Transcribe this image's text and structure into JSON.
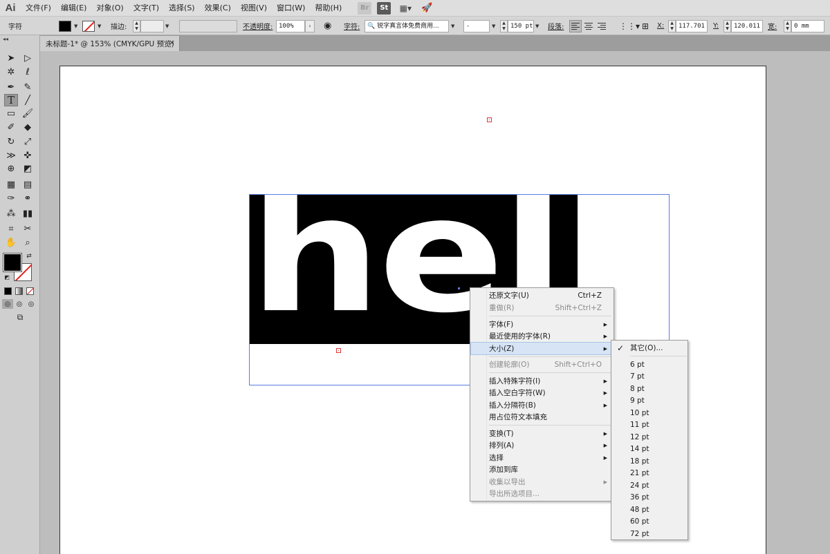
{
  "app": {
    "logo": "Ai"
  },
  "menubar": {
    "items": [
      "文件(F)",
      "编辑(E)",
      "对象(O)",
      "文字(T)",
      "选择(S)",
      "效果(C)",
      "视图(V)",
      "窗口(W)",
      "帮助(H)"
    ],
    "bridge_label": "Br",
    "stock_label": "St"
  },
  "controlbar": {
    "panel_label": "字符",
    "stroke_label": "描边:",
    "opacity_label": "不透明度:",
    "opacity_value": "100%",
    "character_label": "字符:",
    "font_name": "锐字真言体免费商用...",
    "font_style": "-",
    "font_size": "150 pt",
    "paragraph_label": "段落:",
    "x_label": "X:",
    "x_value": "117.701 m",
    "y_label": "Y:",
    "y_value": "120.011 m",
    "w_label": "宽:",
    "w_value": "0 mm"
  },
  "tab": {
    "title": "未标题-1* @ 153% (CMYK/GPU 预览)",
    "close": "×"
  },
  "artboard": {
    "text": "hello"
  },
  "context_menu": {
    "items": [
      {
        "label": "还原文字(U)",
        "shortcut": "Ctrl+Z",
        "enabled": true
      },
      {
        "label": "重做(R)",
        "shortcut": "Shift+Ctrl+Z",
        "enabled": false
      },
      {
        "label": "字体(F)",
        "enabled": true,
        "submenu": true
      },
      {
        "label": "最近使用的字体(R)",
        "enabled": true,
        "submenu": true
      },
      {
        "label": "大小(Z)",
        "enabled": true,
        "submenu": true,
        "highlighted": true
      },
      {
        "label": "创建轮廓(O)",
        "shortcut": "Shift+Ctrl+O",
        "enabled": false
      },
      {
        "label": "插入特殊字符(I)",
        "enabled": true,
        "submenu": true
      },
      {
        "label": "插入空白字符(W)",
        "enabled": true,
        "submenu": true
      },
      {
        "label": "插入分隔符(B)",
        "enabled": true,
        "submenu": true
      },
      {
        "label": "用占位符文本填充",
        "enabled": true
      },
      {
        "label": "变换(T)",
        "enabled": true,
        "submenu": true
      },
      {
        "label": "排列(A)",
        "enabled": true,
        "submenu": true
      },
      {
        "label": "选择",
        "enabled": true,
        "submenu": true
      },
      {
        "label": "添加到库",
        "enabled": true
      },
      {
        "label": "收集以导出",
        "enabled": false,
        "submenu": true
      },
      {
        "label": "导出所选项目...",
        "enabled": false
      }
    ]
  },
  "size_menu": {
    "other_label": "其它(O)...",
    "check": "✓",
    "sizes": [
      "6 pt",
      "7 pt",
      "8 pt",
      "9 pt",
      "10 pt",
      "11 pt",
      "12 pt",
      "14 pt",
      "18 pt",
      "21 pt",
      "24 pt",
      "36 pt",
      "48 pt",
      "60 pt",
      "72 pt"
    ]
  },
  "colors": {
    "highlight": "#d6e4f5",
    "frame": "#5a7be0",
    "anchor": "#e03535"
  }
}
